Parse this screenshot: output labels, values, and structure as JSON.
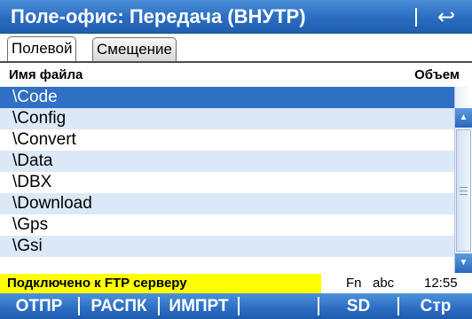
{
  "window": {
    "title": "Поле-офис: Передача (ВНУТР)",
    "back_icon": "↩"
  },
  "tabs": [
    {
      "label": "Полевой",
      "active": true
    },
    {
      "label": "Смещение",
      "active": false
    }
  ],
  "list": {
    "col_name": "Имя файла",
    "col_size": "Объем",
    "selected_index": 0,
    "rows": [
      "\\Code",
      "\\Config",
      "\\Convert",
      "\\Data",
      "\\DBX",
      "\\Download",
      "\\Gps",
      "\\Gsi"
    ]
  },
  "scrollbar": {
    "up_icon": "▲",
    "down_icon": "▼"
  },
  "status": {
    "message": "Подключено к FTP серверу",
    "fn": "Fn",
    "input_mode": "abc",
    "time": "12:55"
  },
  "softkeys": [
    "ОТПР",
    "РАСПК",
    "ИМПРТ",
    "",
    "SD",
    "Стр"
  ],
  "colors": {
    "title_bar": "#2a6cc0",
    "selected_row": "#2f6fc4",
    "alt_row": "#dbe8f8",
    "status_highlight": "#ffff00"
  }
}
